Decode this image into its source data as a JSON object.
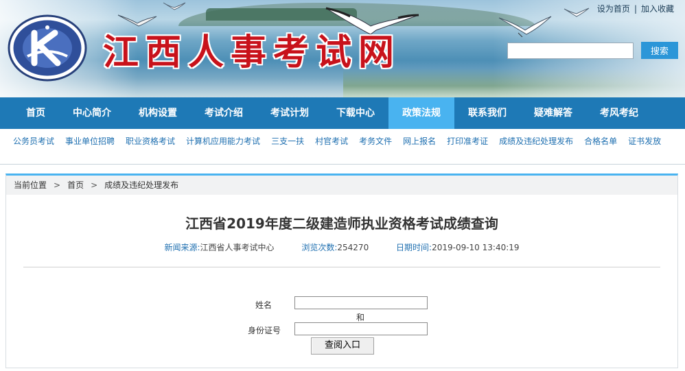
{
  "header": {
    "site_title": "江西人事考试网",
    "top_links": [
      "设为首页",
      "加入收藏"
    ],
    "top_links_separator": "|",
    "search_placeholder": "",
    "search_button": "搜索",
    "logo_icon": "jiangxi-personnel-exam-center-logo"
  },
  "nav": {
    "items": [
      {
        "label": "首页"
      },
      {
        "label": "中心简介"
      },
      {
        "label": "机构设置"
      },
      {
        "label": "考试介绍"
      },
      {
        "label": "考试计划"
      },
      {
        "label": "下载中心"
      },
      {
        "label": "政策法规"
      },
      {
        "label": "联系我们"
      },
      {
        "label": "疑难解答"
      },
      {
        "label": "考风考纪"
      }
    ],
    "active_index": 6,
    "bg_color": "#1e79b6",
    "active_color": "#49b3f0"
  },
  "subnav": {
    "items": [
      "公务员考试",
      "事业单位招聘",
      "职业资格考试",
      "计算机应用能力考试",
      "三支一扶",
      "村官考试",
      "考务文件",
      "网上报名",
      "打印准考证",
      "成绩及违纪处理发布",
      "合格名单",
      "证书发放"
    ]
  },
  "breadcrumb": {
    "label": "当前位置",
    "separator": ">",
    "items": [
      "首页",
      "成绩及违纪处理发布"
    ]
  },
  "article": {
    "title": "江西省2019年度二级建造师执业资格考试成绩查询",
    "source_label": "新闻来源:",
    "source_value": "江西省人事考试中心",
    "views_label": "浏览次数:",
    "views_value": "254270",
    "date_label": "日期时间:",
    "date_value": "2019-09-10 13:40:19"
  },
  "form": {
    "name_label": "姓名",
    "name_value": "",
    "and_text": "和",
    "id_label": "身份证号",
    "id_value": "",
    "submit_label": "查阅入口"
  }
}
